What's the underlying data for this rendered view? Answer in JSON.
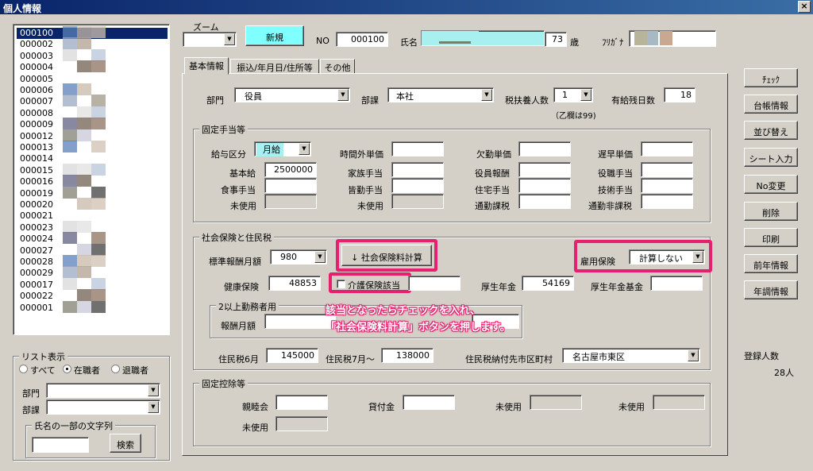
{
  "window": {
    "title": "個人情報",
    "close": "×"
  },
  "list": {
    "items": [
      "000100",
      "000002",
      "000003",
      "000004",
      "000005",
      "000006",
      "000007",
      "000008",
      "000009",
      "000012",
      "000013",
      "000014",
      "000015",
      "000016",
      "000019",
      "000020",
      "000021",
      "000023",
      "000024",
      "000027",
      "000028",
      "000029",
      "000017",
      "000022",
      "000001"
    ]
  },
  "list_display": {
    "title": "リスト表示",
    "radio_all": "すべて",
    "radio_active": "在職者",
    "radio_retired": "退職者",
    "dept_label": "部門",
    "section_label": "部課",
    "name_group_title": "氏名の一部の文字列",
    "name_value": "",
    "search_button": "検索"
  },
  "header": {
    "zoom_label": "ズーム",
    "zoom_value": "",
    "new_button": "新規",
    "no_label": "NO",
    "no_value": "000100",
    "name_label": "氏名",
    "age_value": "73",
    "age_unit": "歳",
    "furigana_label": "ﾌﾘｶﾞﾅ"
  },
  "tabs": [
    "基本情報",
    "振込/年月日/住所等",
    "その他"
  ],
  "basic": {
    "dept_label": "部門",
    "dept_value": "役員",
    "section_label": "部課",
    "section_value": "本社",
    "dependents_label": "税扶養人数",
    "dependents_value": "1",
    "dependents_note": "（乙欄は99)",
    "leave_label": "有給残日数",
    "leave_value": "18"
  },
  "fixed_allowance": {
    "title": "固定手当等",
    "salary_type_label": "給与区分",
    "salary_type_value": "月給",
    "overtime_label": "時間外単価",
    "overtime_value": "",
    "absence_label": "欠勤単価",
    "absence_value": "",
    "late_label": "遅早単価",
    "late_value": "",
    "base_label": "基本給",
    "base_value": "2500000",
    "family_label": "家族手当",
    "family_value": "",
    "exec_label": "役員報酬",
    "exec_value": "",
    "position_label": "役職手当",
    "position_value": "",
    "meal_label": "食事手当",
    "meal_value": "",
    "attendance_label": "皆勤手当",
    "attendance_value": "",
    "housing_label": "住宅手当",
    "housing_value": "",
    "skill_label": "技術手当",
    "skill_value": "",
    "unused1_label": "未使用",
    "unused1_value": "",
    "unused2_label": "未使用",
    "unused2_value": "",
    "commute_taxed_label": "通勤課税",
    "commute_taxed_value": "",
    "commute_nontaxed_label": "通勤非課税",
    "commute_nontaxed_value": ""
  },
  "social": {
    "title": "社会保険と住民税",
    "std_label": "標準報酬月額",
    "std_value": "980",
    "calc_button": "↓ 社会保険料計算",
    "employment_label": "雇用保険",
    "employment_value": "計算しない",
    "health_label": "健康保険",
    "health_value": "48853",
    "care_label": "介護保険該当",
    "care_value": "",
    "pension_label": "厚生年金",
    "pension_value": "54169",
    "pension_fund_label": "厚生年金基金",
    "pension_fund_value": "",
    "multi_title": "2以上勤務者用",
    "remuneration_label": "報酬月額",
    "remuneration_value": "",
    "resident_june_label": "住民税6月",
    "resident_june_value": "145000",
    "resident_july_label": "住民税7月～",
    "resident_july_value": "138000",
    "city_label": "住民税納付先市区町村",
    "city_value": "名古屋市東区"
  },
  "deductions": {
    "title": "固定控除等",
    "mutual_label": "親睦会",
    "mutual_value": "",
    "loan_label": "貸付金",
    "loan_value": "",
    "unused_a_label": "未使用",
    "unused_a_value": "",
    "unused_b_label": "未使用",
    "unused_b_value": "",
    "unused_c_label": "未使用",
    "unused_c_value": ""
  },
  "annotation": {
    "line1": "該当となったらチェックを入れ、",
    "line2": "「社会保険料計算」ボタンを押します。"
  },
  "side_buttons": [
    "ﾁｪｯｸ",
    "台帳情報",
    "並び替え",
    "シート入力",
    "No変更",
    "削除",
    "印刷",
    "前年情報",
    "年調情報"
  ],
  "registered": {
    "label": "登録人数",
    "value": "28人"
  },
  "colors": {
    "accent": "#e6206e",
    "title_bar": "#0a246a",
    "name_field": "#a8f0f0",
    "new_button": "#80ffff"
  }
}
